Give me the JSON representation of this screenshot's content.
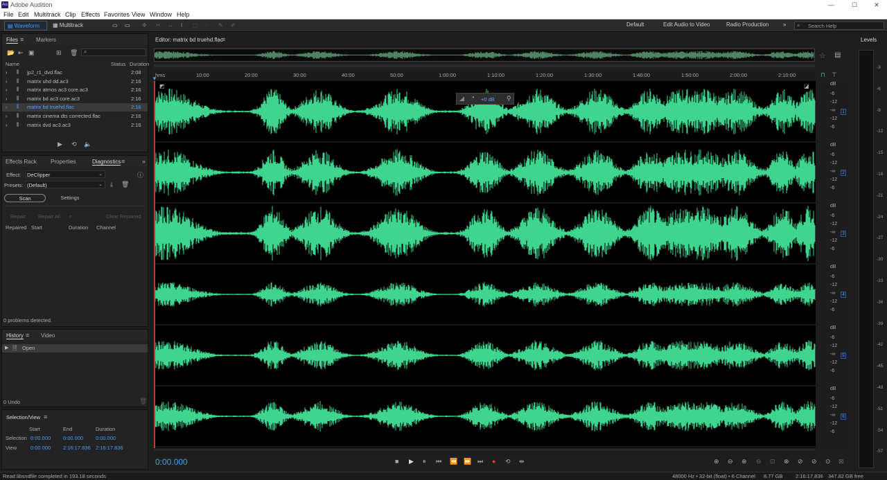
{
  "app": {
    "title": "Adobe Audition",
    "logo": "Au"
  },
  "menu": [
    "File",
    "Edit",
    "Multitrack",
    "Clip",
    "Effects",
    "Favorites",
    "View",
    "Window",
    "Help"
  ],
  "toolbar": {
    "waveform": "Waveform",
    "multitrack": "Multitrack",
    "workspaces": [
      "Default",
      "Edit Audio to Video",
      "Radio Production"
    ],
    "search_placeholder": "Search Help"
  },
  "files_panel": {
    "tabs": [
      "Files",
      "Markers"
    ],
    "columns": [
      "Name",
      "Status",
      "Duration"
    ],
    "files": [
      {
        "name": "jp2_r1_dvd.flac",
        "duration": "2:08"
      },
      {
        "name": "matrix uhd dd.ac3",
        "duration": "2:16"
      },
      {
        "name": "matrix atmos ac3 core.ac3",
        "duration": "2:16"
      },
      {
        "name": "matrix bd ac3 core.ac3",
        "duration": "2:16"
      },
      {
        "name": "matrix bd truehd.flac",
        "duration": "2:16",
        "selected": true
      },
      {
        "name": "matrix cinema dts corrected.flac",
        "duration": "2:16"
      },
      {
        "name": "matrix dvd ac3.ac3",
        "duration": "2:16"
      }
    ]
  },
  "diag_panel": {
    "tabs": [
      "Effects Rack",
      "Properties",
      "Diagnostics"
    ],
    "effect_label": "Effect:",
    "effect_value": "DeClipper",
    "presets_label": "Presets:",
    "presets_value": "(Default)",
    "scan": "Scan",
    "settings": "Settings",
    "repair": "Repair",
    "repair_all": "Repair All",
    "clear_repaired": "Clear Repaired",
    "columns": [
      "Repaired",
      "Start",
      "Duration",
      "Channel"
    ],
    "status": "0 problems detected."
  },
  "history_panel": {
    "tabs": [
      "History",
      "Video"
    ],
    "items": [
      "Open"
    ],
    "undo": "0 Undo"
  },
  "selection_panel": {
    "title": "Selection/View",
    "columns": [
      "Start",
      "End",
      "Duration"
    ],
    "rows": [
      {
        "label": "Selection",
        "start": "0:00.000",
        "end": "0:00.000",
        "duration": "0:00.000"
      },
      {
        "label": "View",
        "start": "0:00.000",
        "end": "2:16:17.836",
        "duration": "2:16:17.836"
      }
    ]
  },
  "editor": {
    "title": "Editor: matrix bd truehd.flac",
    "hud_gain": "+0 dB",
    "ruler_unit": "hms",
    "ruler_ticks": [
      "10:00",
      "20:00",
      "30:00",
      "40:00",
      "50:00",
      "1:00:00",
      "1:10:00",
      "1:20:00",
      "1:30:00",
      "1:40:00",
      "1:50:00",
      "2:00:00",
      "2:10:00"
    ],
    "db_labels": [
      "dB",
      "-6",
      "-12",
      "-∞",
      "-12",
      "-6"
    ],
    "channels": [
      "1",
      "2",
      "3",
      "4",
      "5",
      "6"
    ],
    "current_time": "0:00.000",
    "wave_color": "#3fd58f"
  },
  "levels_panel": {
    "title": "Levels",
    "scale": [
      "-3",
      "-6",
      "-9",
      "-12",
      "-15",
      "-18",
      "-21",
      "-24",
      "-27",
      "-30",
      "-33",
      "-36",
      "-39",
      "-42",
      "-45",
      "-48",
      "-51",
      "-54",
      "-57"
    ]
  },
  "status_bar": {
    "message": "Read libsndfile completed in 193.18 seconds",
    "format": "48000 Hz • 32-bit (float) • 6 Channel",
    "size": "8.77 GB",
    "duration": "2:16:17.836",
    "free": "347.82 GB free"
  }
}
